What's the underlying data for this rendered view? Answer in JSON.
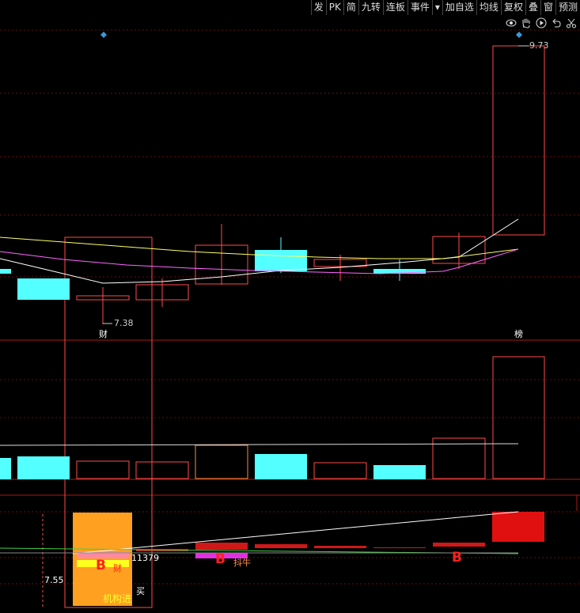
{
  "toolbar": {
    "buttons": [
      "发",
      "PK",
      "简",
      "九转",
      "连板",
      "事件",
      "▾",
      "加自选",
      "均线",
      "复权",
      "叠",
      "窗",
      "预测"
    ]
  },
  "icons": [
    "eye-icon",
    "hand-icon",
    "play-icon",
    "undo-icon",
    "scissors-icon"
  ],
  "markers": {
    "high_price": "9.73",
    "low_price": "7.38",
    "bottom_price": "7.55",
    "finance_tag": "财",
    "rank_tag": "榜",
    "volume_value": "11379",
    "buy_text": "买",
    "institution_text": "机构进",
    "cai_text": "财",
    "b_signal": "B",
    "signal_text": "抖牛"
  },
  "colors": {
    "up": "#ff3b3b",
    "down": "#54ffff",
    "grid": "#7a1010",
    "ma5": "#ffffff",
    "ma10": "#ffff66",
    "ma20": "#ff66ff",
    "orange": "#ffa020"
  }
}
